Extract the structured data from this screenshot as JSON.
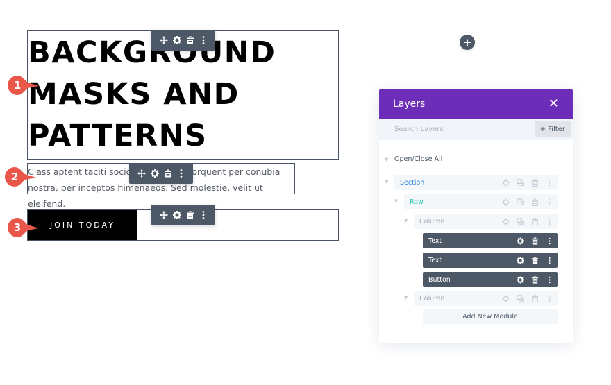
{
  "canvas": {
    "heading": {
      "text": "BACKGROUND\nMASKS AND\nPATTERNS"
    },
    "body_text": "Class aptent taciti sociosqu ad litora torquent per conubia nostra, per inceptos himenaeos. Sed molestie, velit ut eleifend.",
    "button": {
      "label": "JOIN TODAY"
    },
    "module_toolbar": {
      "icons": [
        "move-icon",
        "gear-icon",
        "trash-icon",
        "more-vertical-icon"
      ]
    },
    "badges": [
      "1",
      "2",
      "3"
    ],
    "add_section_icon": "+"
  },
  "layers_panel": {
    "title": "Layers",
    "close_icon": "✕",
    "search_placeholder": "Search Layers",
    "filter_label": "+ Filter",
    "open_close_all": "Open/Close All",
    "caret": "▼",
    "items": [
      {
        "label": "Section",
        "type": "section",
        "color": "#2b87da"
      },
      {
        "label": "Row",
        "type": "row",
        "color": "#29c4a9"
      },
      {
        "label": "Column",
        "type": "column",
        "color": "#a2adb8"
      },
      {
        "label": "Text",
        "type": "module"
      },
      {
        "label": "Text",
        "type": "module"
      },
      {
        "label": "Button",
        "type": "module"
      },
      {
        "label": "Column",
        "type": "column",
        "color": "#a2adb8"
      }
    ],
    "add_new_module": "Add New Module"
  },
  "colors": {
    "accent_purple": "#6c2eb9",
    "toolbar_gray": "#4c5866",
    "badge_red": "#e8574a"
  }
}
